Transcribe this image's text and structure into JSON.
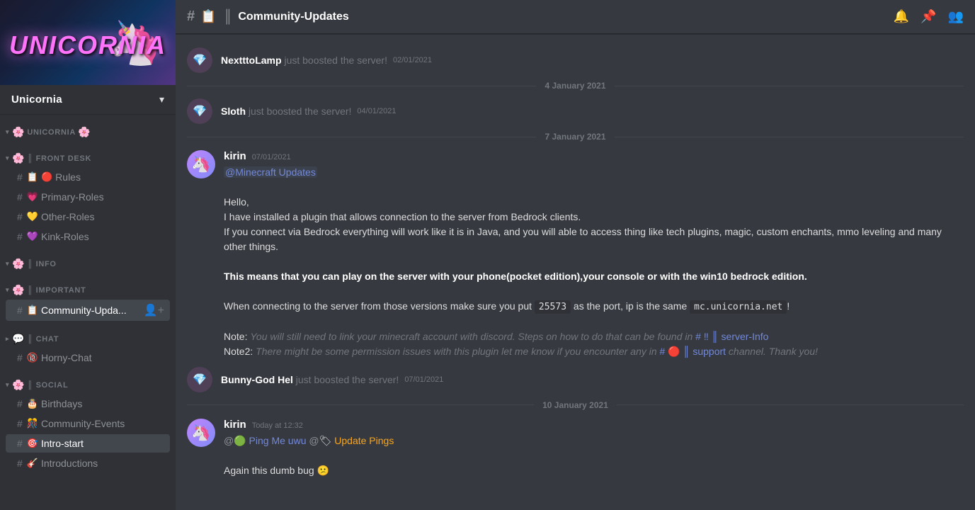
{
  "server": {
    "name": "Unicornia",
    "dropdown_arrow": "▾"
  },
  "sidebar": {
    "sections": [
      {
        "id": "unicornia",
        "label": "UNICORNIA",
        "prefix": "🌸",
        "suffix": "🌸",
        "items": []
      },
      {
        "id": "frontdesk",
        "label": "FRONT DESK",
        "prefix": "🌸",
        "items": [
          {
            "icon": "📋",
            "name": "Rules",
            "hash": true,
            "extra_icon": "🔴"
          },
          {
            "icon": "💗",
            "name": "Primary-Roles",
            "hash": true
          },
          {
            "icon": "💛",
            "name": "Other-Roles",
            "hash": true
          },
          {
            "icon": "💜",
            "name": "Kink-Roles",
            "hash": true
          }
        ]
      },
      {
        "id": "info",
        "label": "INFO",
        "prefix": "🌸",
        "items": []
      },
      {
        "id": "important",
        "label": "IMPORTANT",
        "prefix": "🌸",
        "items": [
          {
            "icon": "📋",
            "name": "Community-Upda...",
            "hash": true,
            "active": true,
            "add_user": true
          }
        ]
      },
      {
        "id": "chat",
        "label": "CHAT",
        "prefix": "💬",
        "items": [
          {
            "icon": "🔞",
            "name": "Horny-Chat",
            "hash": true
          }
        ]
      },
      {
        "id": "social",
        "label": "SOCIAL",
        "prefix": "🌸",
        "items": [
          {
            "icon": "🎂",
            "name": "Birthdays",
            "hash": true
          },
          {
            "icon": "🎊",
            "name": "Community-Events",
            "hash": true
          },
          {
            "icon": "🎯",
            "name": "Intro-start",
            "hash": true,
            "active_current": true
          },
          {
            "icon": "🎸",
            "name": "Introductions",
            "hash": true
          }
        ]
      }
    ]
  },
  "channel": {
    "hash": "#",
    "icon": "📋",
    "separator": "║",
    "name": "Community-Updates"
  },
  "header_actions": {
    "bell": "🔔",
    "pin": "📌",
    "members": "👥"
  },
  "messages": [
    {
      "type": "boost",
      "username": "NextttoLamp",
      "text": "just boosted the server!",
      "timestamp": "02/01/2021"
    },
    {
      "type": "date_divider",
      "label": "4 January 2021"
    },
    {
      "type": "boost",
      "username": "Sloth",
      "text": "just boosted the server!",
      "timestamp": "04/01/2021"
    },
    {
      "type": "date_divider",
      "label": "7 January 2021"
    },
    {
      "type": "message",
      "id": "msg1",
      "author": "kirin",
      "timestamp": "07/01/2021",
      "avatar_color": "#c084fc",
      "lines": [
        {
          "type": "mention",
          "text": "@Minecraft Updates"
        },
        {
          "type": "blank"
        },
        {
          "type": "plain",
          "text": "Hello,"
        },
        {
          "type": "plain",
          "text": "I have installed a plugin that allows connection to the server from Bedrock clients."
        },
        {
          "type": "plain",
          "text": "If you connect via Bedrock everything will work like it is in Java, and you will able to access thing like tech plugins, magic, custom enchants, mmo leveling and many other things."
        },
        {
          "type": "blank"
        },
        {
          "type": "bold",
          "text": "This means that you can play on the server with your phone(pocket edition),your console or with the win10 bedrock edition."
        },
        {
          "type": "blank"
        },
        {
          "type": "mixed_port",
          "before": "When connecting to the server from those versions make sure you put ",
          "code": "25573",
          "after": " as the port, ip is the same ",
          "code2": "mc.unicornia.net",
          "end": "!"
        },
        {
          "type": "blank"
        },
        {
          "type": "note1",
          "before": "Note: ",
          "italic": "You will still need to link your minecraft account with discord. Steps on how to do that can be found in ",
          "channel_link": "# ‼ ║ server-Info"
        },
        {
          "type": "note2",
          "before": "Note2: ",
          "italic": "There might be some permission issues with this plugin let me know if you encounter any in ",
          "channel_link": "# 🔴 ║ support",
          "after": " channel. Thank you!"
        }
      ]
    },
    {
      "type": "boost",
      "username": "Bunny-God Hel",
      "text": "just boosted the server!",
      "timestamp": "07/01/2021"
    },
    {
      "type": "date_divider",
      "label": "10 January 2021"
    },
    {
      "type": "message",
      "id": "msg2",
      "author": "kirin",
      "timestamp": "Today at 12:32",
      "avatar_color": "#c084fc",
      "lines": [
        {
          "type": "ping_line",
          "at1": "@",
          "green_dot": "🟢",
          "ping1": "Ping Me uwu",
          "at2": "@",
          "tag_icon": "🏷",
          "ping2": "Update Pings"
        },
        {
          "type": "blank"
        },
        {
          "type": "plain_emoji",
          "text": "Again this dumb bug 😕"
        }
      ]
    }
  ]
}
